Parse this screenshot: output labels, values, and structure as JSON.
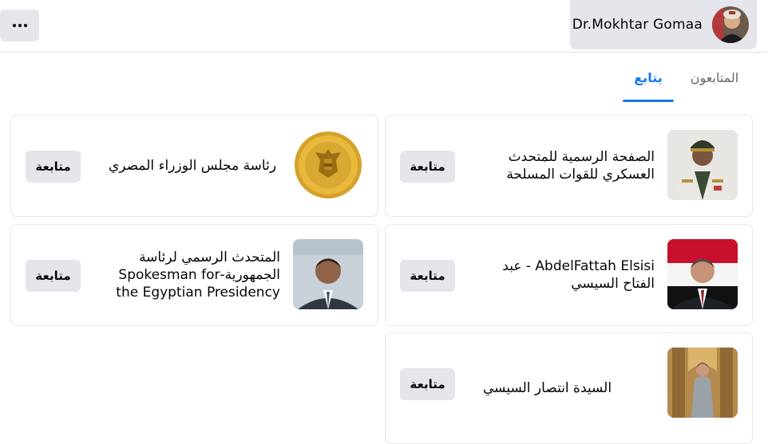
{
  "header": {
    "profile_name": "Dr.Mokhtar Gomaa",
    "more_icon": "more-horizontal-icon"
  },
  "tabs": [
    {
      "label": "المتابعون",
      "active": false
    },
    {
      "label": "يتابع",
      "active": true
    }
  ],
  "accent_color": "#1877f2",
  "following": [
    {
      "name": "الصفحة الرسمية للمتحدث العسكري للقوات المسلحة",
      "button": "متابعة"
    },
    {
      "name": "رئاسة مجلس الوزراء المصري",
      "button": "متابعة"
    },
    {
      "name": "AbdelFattah Elsisi - عبد الفتاح السيسي",
      "button": "متابعة"
    },
    {
      "name": "المتحدث الرسمي لرئاسة الجمهورية-Spokesman for the Egyptian Presidency",
      "button": "متابعة"
    },
    {
      "name": "السيدة انتصار السيسي",
      "button": "متابعة"
    }
  ]
}
